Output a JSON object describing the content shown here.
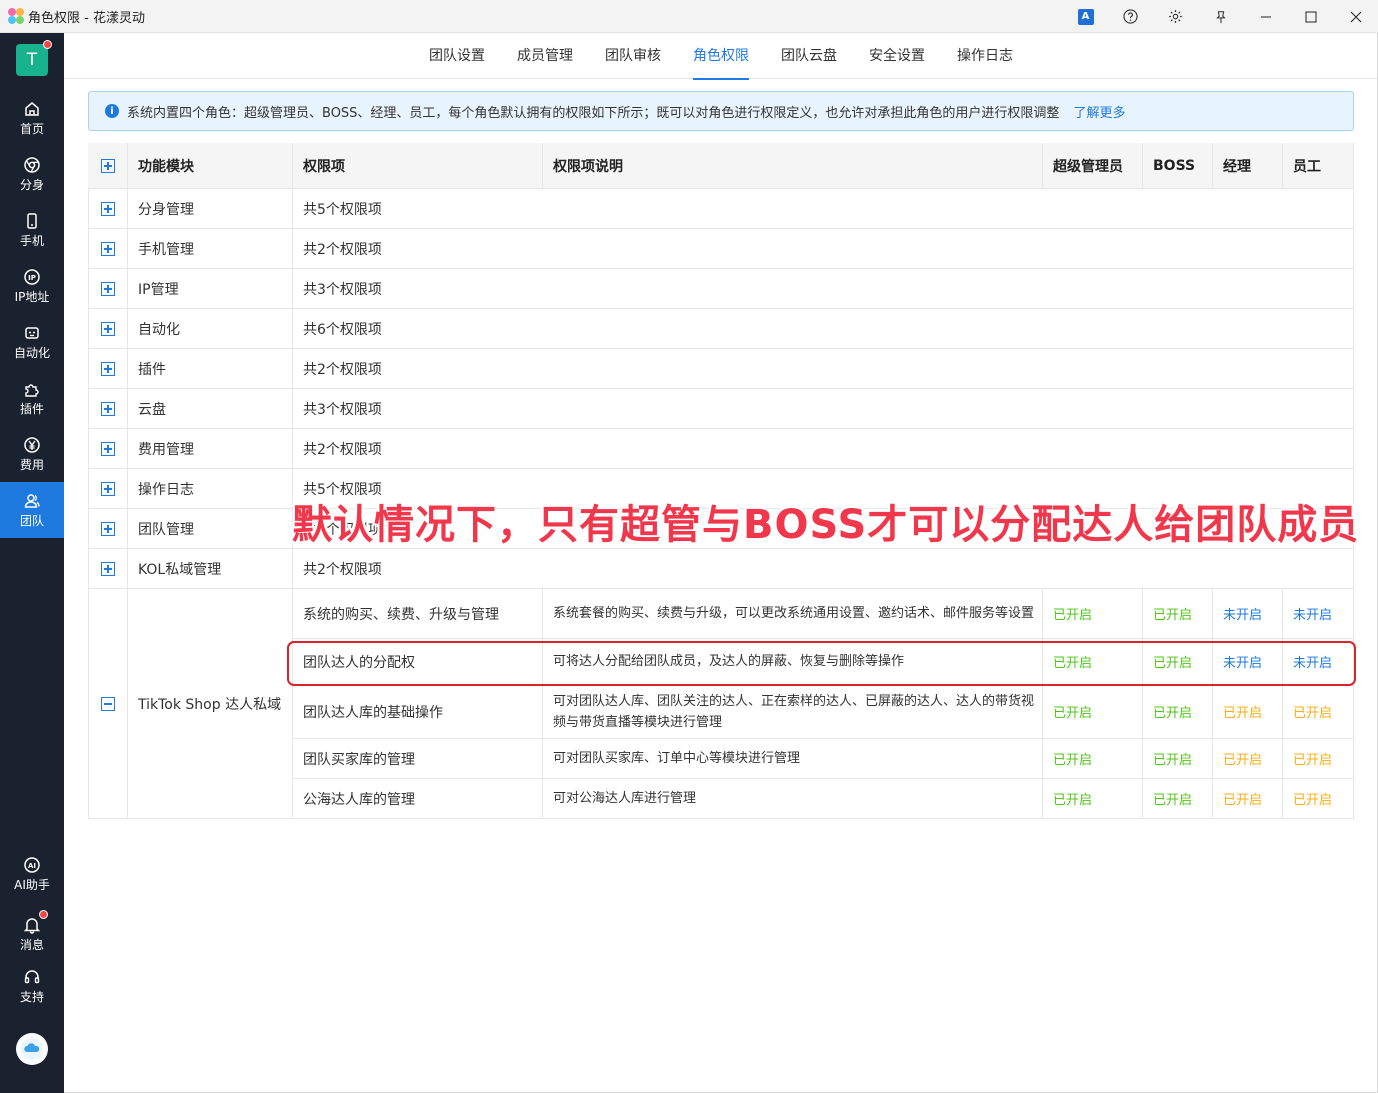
{
  "window": {
    "title": "角色权限 - 花漾灵动",
    "translate_label": "A"
  },
  "sidebar": {
    "avatar_letter": "T",
    "items": [
      {
        "label": "首页",
        "icon": "home-icon"
      },
      {
        "label": "分身",
        "icon": "chrome-icon"
      },
      {
        "label": "手机",
        "icon": "phone-icon"
      },
      {
        "label": "IP地址",
        "icon": "ip-icon"
      },
      {
        "label": "自动化",
        "icon": "robot-icon"
      },
      {
        "label": "插件",
        "icon": "puzzle-icon"
      },
      {
        "label": "费用",
        "icon": "yen-icon"
      },
      {
        "label": "团队",
        "icon": "team-icon"
      }
    ],
    "bottom_items": [
      {
        "label": "AI助手",
        "icon": "ai-icon"
      },
      {
        "label": "消息",
        "icon": "bell-icon"
      },
      {
        "label": "支持",
        "icon": "headset-icon"
      }
    ]
  },
  "tabs": [
    "团队设置",
    "成员管理",
    "团队审核",
    "角色权限",
    "团队云盘",
    "安全设置",
    "操作日志"
  ],
  "active_tab": "角色权限",
  "info": {
    "text": "系统内置四个角色：超级管理员、BOSS、经理、员工，每个角色默认拥有的权限如下所示；既可以对角色进行权限定义，也允许对承担此角色的用户进行权限调整",
    "link": "了解更多"
  },
  "table": {
    "headers": [
      "功能模块",
      "权限项",
      "权限项说明",
      "超级管理员",
      "BOSS",
      "经理",
      "员工"
    ],
    "collapsed_rows": [
      {
        "module": "分身管理",
        "summary": "共5个权限项"
      },
      {
        "module": "手机管理",
        "summary": "共2个权限项"
      },
      {
        "module": "IP管理",
        "summary": "共3个权限项"
      },
      {
        "module": "自动化",
        "summary": "共6个权限项"
      },
      {
        "module": "插件",
        "summary": "共2个权限项"
      },
      {
        "module": "云盘",
        "summary": "共3个权限项"
      },
      {
        "module": "费用管理",
        "summary": "共2个权限项"
      },
      {
        "module": "操作日志",
        "summary": "共5个权限项"
      },
      {
        "module": "团队管理",
        "summary": "共8个权限项"
      },
      {
        "module": "KOL私域管理",
        "summary": "共2个权限项"
      }
    ],
    "expanded_module": "TikTok Shop 达人私域",
    "expanded_rows": [
      {
        "item": "系统的购买、续费、升级与管理",
        "desc": "系统套餐的购买、续费与升级，可以更改系统通用设置、邀约话术、邮件服务等设置",
        "status": [
          "已开启",
          "已开启",
          "未开启",
          "未开启"
        ],
        "kind": [
          "on",
          "on",
          "off",
          "off"
        ]
      },
      {
        "item": "团队达人的分配权",
        "desc": "可将达人分配给团队成员，及达人的屏蔽、恢复与删除等操作",
        "status": [
          "已开启",
          "已开启",
          "未开启",
          "未开启"
        ],
        "kind": [
          "on",
          "on",
          "off",
          "off"
        ]
      },
      {
        "item": "团队达人库的基础操作",
        "desc": "可对团队达人库、团队关注的达人、正在索样的达人、已屏蔽的达人、达人的带货视频与带货直播等模块进行管理",
        "status": [
          "已开启",
          "已开启",
          "已开启",
          "已开启"
        ],
        "kind": [
          "on",
          "on",
          "orange",
          "orange"
        ]
      },
      {
        "item": "团队买家库的管理",
        "desc": "可对团队买家库、订单中心等模块进行管理",
        "status": [
          "已开启",
          "已开启",
          "已开启",
          "已开启"
        ],
        "kind": [
          "on",
          "on",
          "orange",
          "orange"
        ]
      },
      {
        "item": "公海达人库的管理",
        "desc": "可对公海达人库进行管理",
        "status": [
          "已开启",
          "已开启",
          "已开启",
          "已开启"
        ],
        "kind": [
          "on",
          "on",
          "orange",
          "orange"
        ]
      }
    ]
  },
  "annotation": "默认情况下，只有超管与BOSS才可以分配达人给团队成员",
  "colors": {
    "sidebar_bg": "#1a2230",
    "accent": "#1f7ae0",
    "enabled": "#52c41a",
    "enabled_orange": "#faad14",
    "highlight": "#d9232d",
    "annotation": "#f0374b"
  }
}
